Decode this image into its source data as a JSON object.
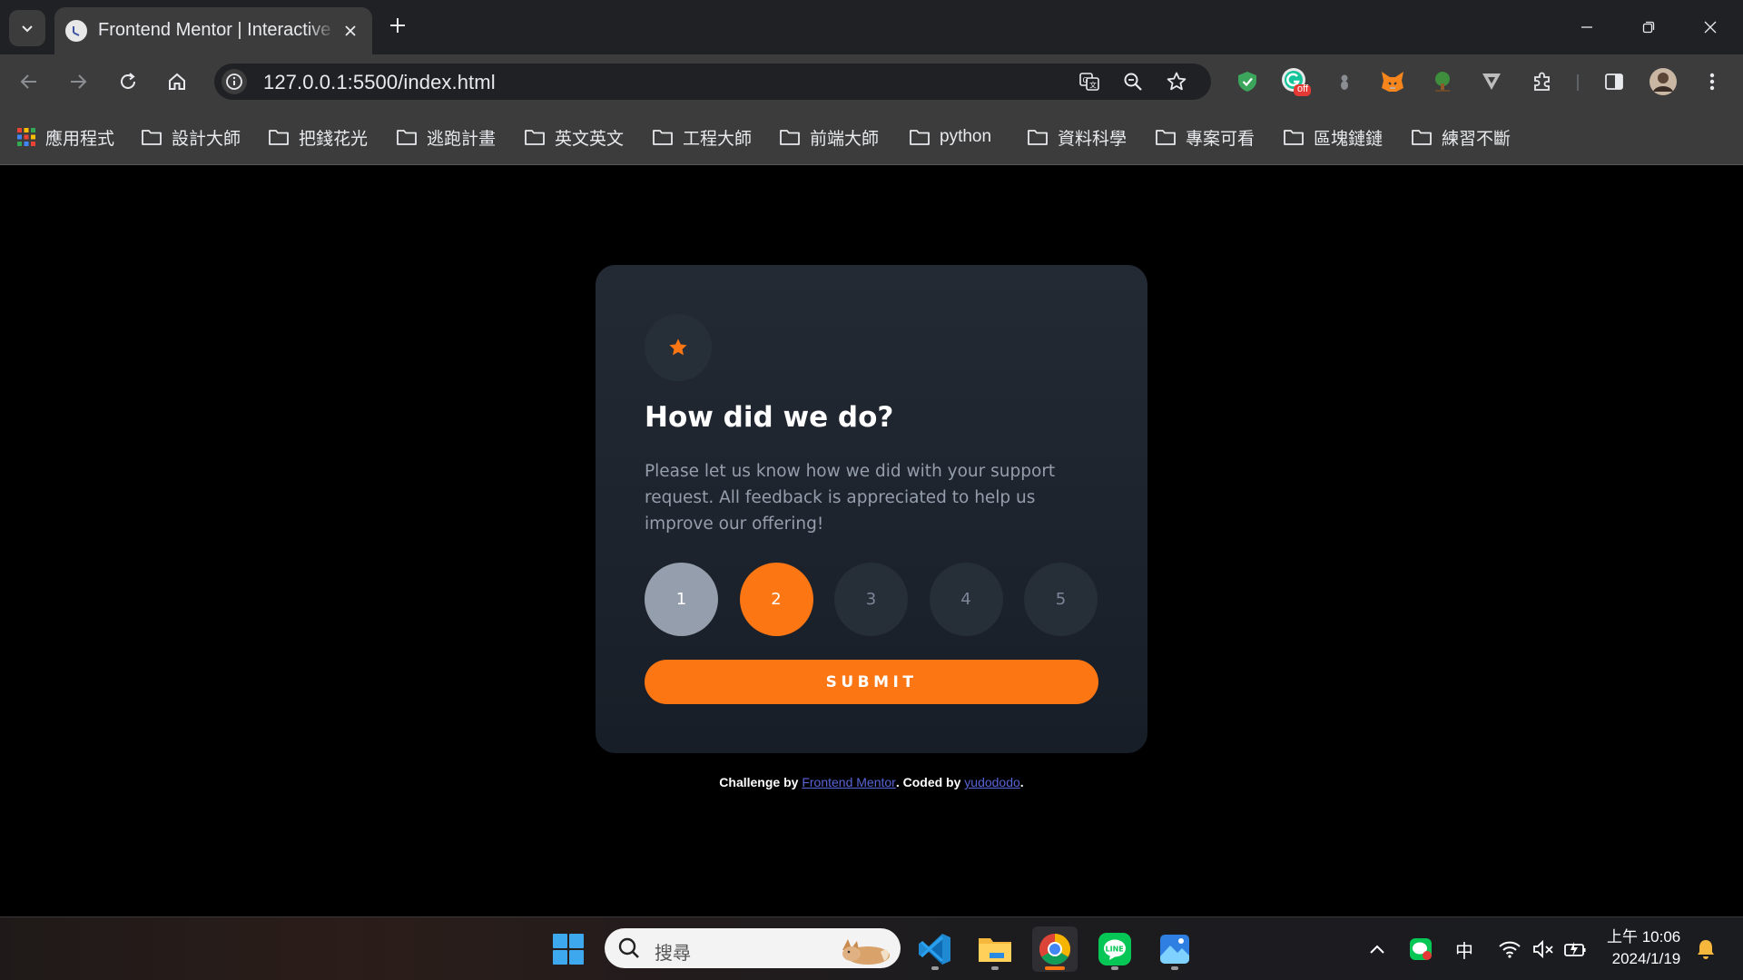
{
  "browser": {
    "tab_title": "Frontend Mentor | Interactive rating component",
    "url": "127.0.0.1:5500/index.html",
    "extension_badge": "off",
    "bookmarks": [
      {
        "label": "應用程式",
        "icon": "apps-grid-icon"
      },
      {
        "label": "設計大師",
        "icon": "folder-icon"
      },
      {
        "label": "把錢花光",
        "icon": "folder-icon"
      },
      {
        "label": "逃跑計畫",
        "icon": "folder-icon"
      },
      {
        "label": "英文英文",
        "icon": "folder-icon"
      },
      {
        "label": "工程大師",
        "icon": "folder-icon"
      },
      {
        "label": "前端大師",
        "icon": "folder-icon"
      },
      {
        "label": "python",
        "icon": "folder-icon"
      },
      {
        "label": "資料科學",
        "icon": "folder-icon"
      },
      {
        "label": "專案可看",
        "icon": "folder-icon"
      },
      {
        "label": "區塊鏈鏈",
        "icon": "folder-icon"
      },
      {
        "label": "練習不斷",
        "icon": "folder-icon"
      }
    ]
  },
  "card": {
    "title": "How did we do?",
    "description": "Please let us know how we did with your support request. All feedback is appreciated to help us improve our offering!",
    "ratings": [
      "1",
      "2",
      "3",
      "4",
      "5"
    ],
    "hovered_rating": "1",
    "selected_rating": "2",
    "submit_label": "SUBMIT"
  },
  "attribution": {
    "prefix": "Challenge by ",
    "link1": "Frontend Mentor",
    "middle": ". Coded by ",
    "link2": "yudododo",
    "suffix": "."
  },
  "taskbar": {
    "search_placeholder": "搜尋",
    "ime": "中",
    "time": "上午 10:06",
    "date": "2024/1/19"
  },
  "colors": {
    "accent": "#fc7614",
    "card_bg": "#1e252e",
    "muted": "#959eac",
    "link": "#5764d6"
  }
}
